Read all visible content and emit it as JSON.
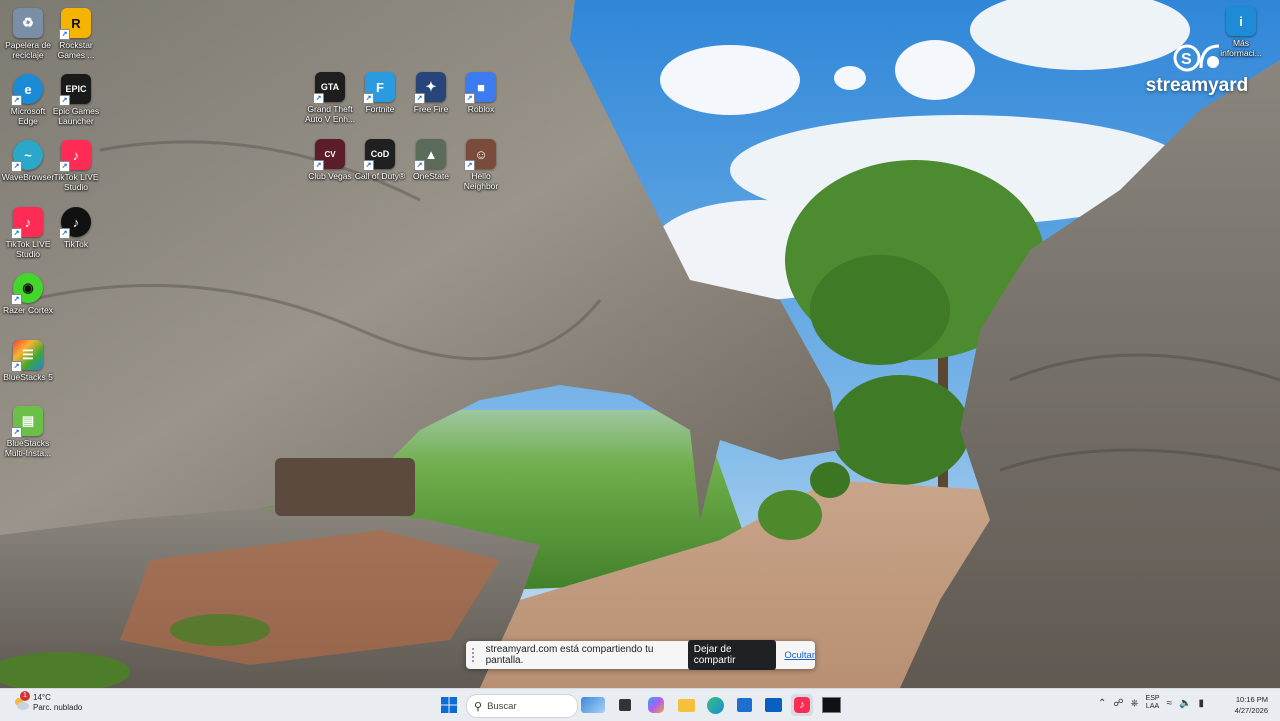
{
  "desktop": {
    "icons": [
      {
        "label": "Papelera de reciclaje",
        "icon": "recycle-bin-icon",
        "color": "#7a8fa6"
      },
      {
        "label": "Rockstar Games ...",
        "icon": "rockstar-icon",
        "color": "#f5b400",
        "glyph": "R"
      },
      {
        "label": "Microsoft Edge",
        "icon": "edge-icon",
        "color": "#1b8bd6"
      },
      {
        "label": "Epic Games Launcher",
        "icon": "epic-games-icon",
        "color": "#1a1a1a",
        "glyph": "EPIC"
      },
      {
        "label": "WaveBrowser",
        "icon": "wavebrowser-icon",
        "color": "#2aa7c9"
      },
      {
        "label": "TikTok LIVE Studio",
        "icon": "tiktok-live-icon",
        "color": "#fe2c55"
      },
      {
        "label": "TikTok LIVE Studio",
        "icon": "tiktok-live-icon",
        "color": "#fe2c55"
      },
      {
        "label": "TikTok",
        "icon": "tiktok-icon",
        "color": "#111111"
      },
      {
        "label": "Razer Cortex",
        "icon": "razer-cortex-icon",
        "color": "#44d62c"
      },
      {
        "label": "BlueStacks 5",
        "icon": "bluestacks-icon",
        "color": "#3ea535"
      },
      {
        "label": "BlueStacks Multi-Insta...",
        "icon": "bluestacks-multi-icon",
        "color": "#6cc04a"
      },
      {
        "label": "Grand Theft Auto V Enh...",
        "icon": "gta-icon",
        "color": "#1e1e1e",
        "glyph": "GTA"
      },
      {
        "label": "Fortnite",
        "icon": "fortnite-icon",
        "color": "#2a9be0",
        "glyph": "F"
      },
      {
        "label": "Free Fire",
        "icon": "free-fire-icon",
        "color": "#27457a"
      },
      {
        "label": "Roblox",
        "icon": "roblox-icon",
        "color": "#3d7bf0"
      },
      {
        "label": "Club Vegas",
        "icon": "club-vegas-icon",
        "color": "#5b1d2a"
      },
      {
        "label": "Call of Duty®",
        "icon": "call-of-duty-icon",
        "color": "#202020",
        "glyph": "CoD"
      },
      {
        "label": "OneState",
        "icon": "onestate-icon",
        "color": "#5a6b5a"
      },
      {
        "label": "Hello Neighbor",
        "icon": "hello-neighbor-icon",
        "color": "#7a4a3a"
      }
    ],
    "info_icon": {
      "label": "Más informaci...",
      "icon": "info-icon",
      "color": "#1e8bd6"
    },
    "streamyard": {
      "wordmark": "streamyard"
    }
  },
  "share_notification": {
    "message": "streamyard.com está compartiendo tu pantalla.",
    "stop_label": "Dejar de compartir",
    "hide_label": "Ocultar"
  },
  "taskbar": {
    "weather": {
      "temp": "14°C",
      "desc": "Parc. nublado",
      "badge": "1"
    },
    "search_placeholder": "Buscar",
    "apps": [
      "start-icon",
      "file-explorer-icon",
      "taskview-icon",
      "copilot-icon",
      "folder-icon",
      "edge-icon",
      "store-icon",
      "outlook-icon",
      "tiktok-live-icon",
      "obs-icon"
    ],
    "tray": {
      "lang_top": "ESP",
      "lang_bottom": "LAA"
    },
    "clock": {
      "time": "10:16 PM",
      "date": "4/27/2026"
    }
  }
}
